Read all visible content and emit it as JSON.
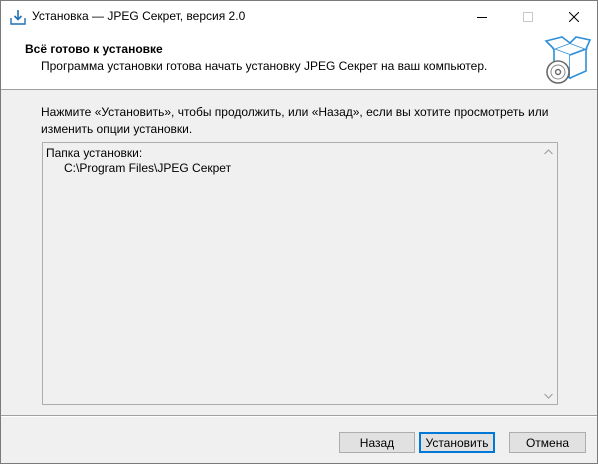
{
  "window": {
    "title": "Установка — JPEG Секрет, версия 2.0"
  },
  "header": {
    "title": "Всё готово к установке",
    "subtitle": "Программа установки готова начать установку JPEG Секрет на ваш компьютер."
  },
  "main": {
    "instruction_line1": "Нажмите «Установить», чтобы продолжить, или «Назад», если вы хотите просмотреть или",
    "instruction_line2": "изменить опции установки.",
    "memo": {
      "label": "Папка установки:",
      "path": "C:\\Program Files\\JPEG Секрет"
    }
  },
  "buttons": {
    "back": "Назад",
    "install": "Установить",
    "cancel": "Отмена"
  },
  "icons": {
    "app": "installer-download-icon",
    "header": "box-with-disc-icon"
  },
  "colors": {
    "accent": "#0078d7",
    "icon_blue": "#2f8fd8"
  }
}
